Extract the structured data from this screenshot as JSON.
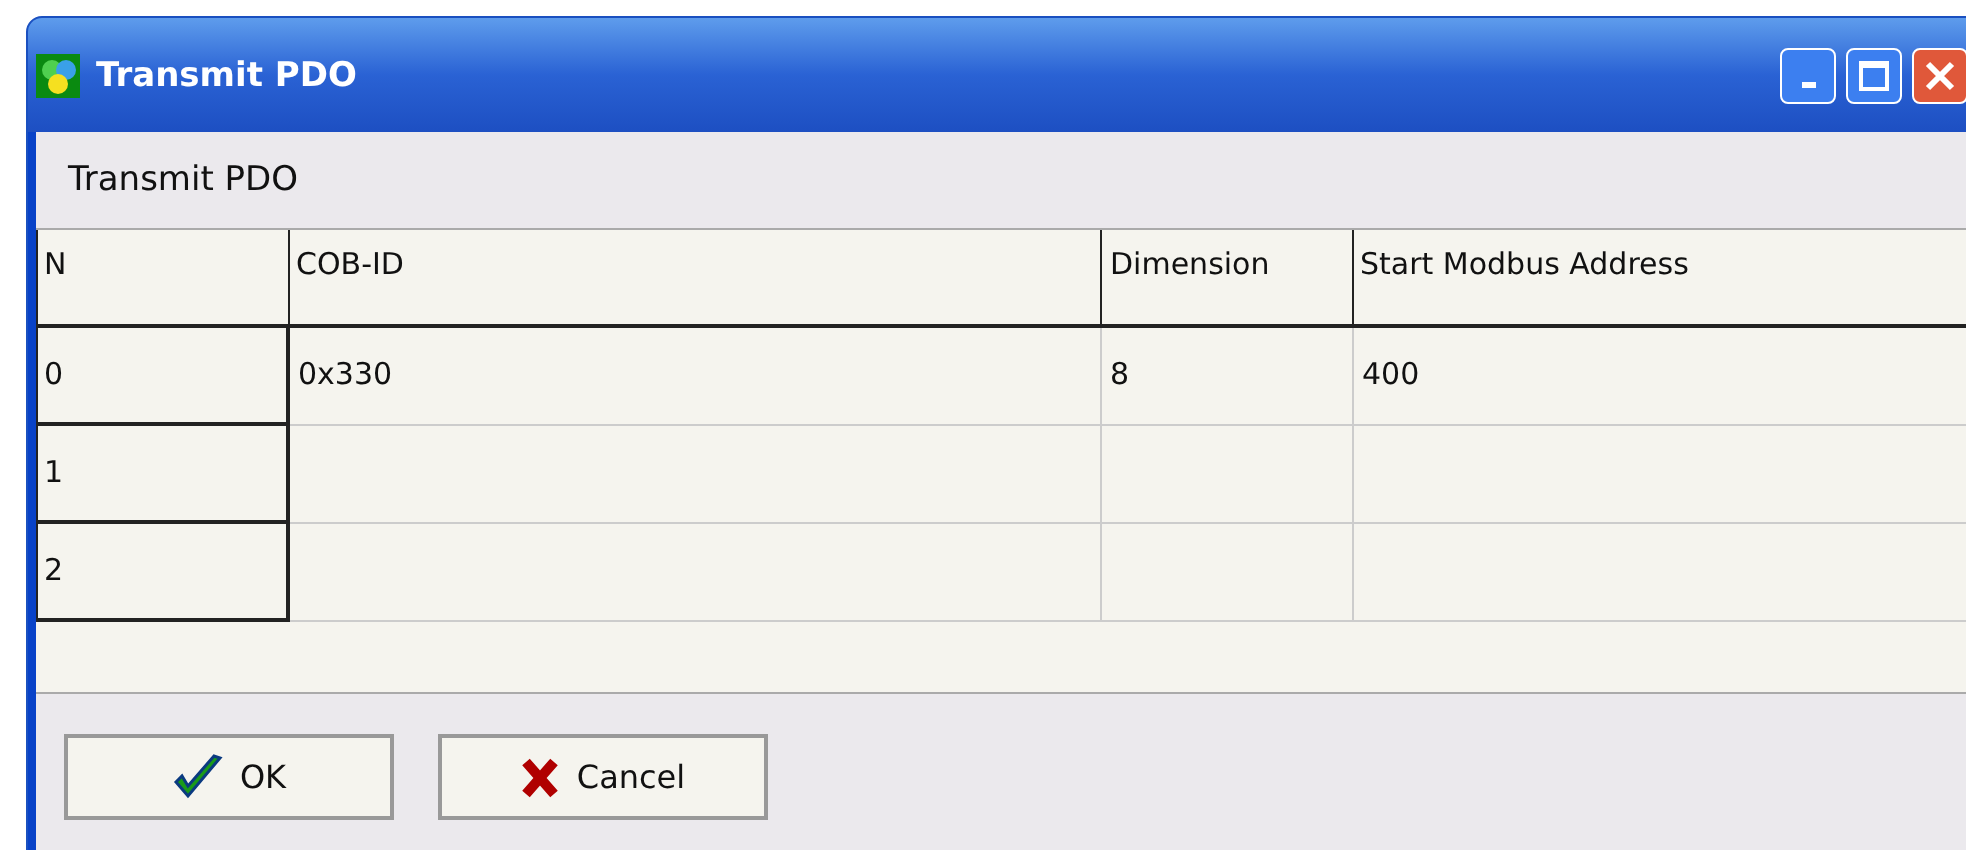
{
  "window": {
    "title": "Transmit PDO"
  },
  "panel": {
    "title": "Transmit PDO"
  },
  "table": {
    "columns": [
      "N",
      "COB-ID",
      "Dimension",
      "Start Modbus Address"
    ],
    "rows": [
      [
        "0",
        "0x330",
        "8",
        "400"
      ],
      [
        "1",
        "",
        "",
        ""
      ],
      [
        "2",
        "",
        "",
        ""
      ]
    ]
  },
  "buttons": [
    {
      "kind": "ok",
      "label": "OK"
    },
    {
      "kind": "cancel",
      "label": "Cancel"
    }
  ]
}
